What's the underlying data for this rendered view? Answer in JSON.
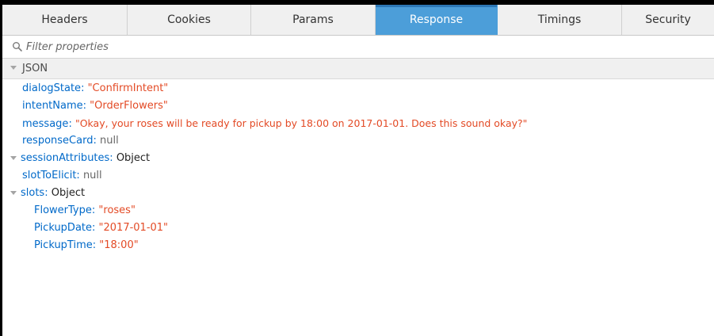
{
  "tabs": [
    {
      "label": "Headers",
      "active": false
    },
    {
      "label": "Cookies",
      "active": false
    },
    {
      "label": "Params",
      "active": false
    },
    {
      "label": "Response",
      "active": true
    },
    {
      "label": "Timings",
      "active": false
    },
    {
      "label": "Security",
      "active": false
    }
  ],
  "filter": {
    "placeholder": "Filter properties",
    "icon": "search-icon"
  },
  "json_section": {
    "label": "JSON",
    "expanded": true
  },
  "properties": [
    {
      "key": "dialogState",
      "value": "\"ConfirmIntent\"",
      "type": "string"
    },
    {
      "key": "intentName",
      "value": "\"OrderFlowers\"",
      "type": "string"
    },
    {
      "key": "message",
      "value": "\"Okay, your roses will be ready for pickup by 18:00 on 2017-01-01.  Does this sound okay?\"",
      "type": "string"
    },
    {
      "key": "responseCard",
      "value": "null",
      "type": "null"
    },
    {
      "key": "sessionAttributes",
      "value": "Object",
      "type": "object",
      "expanded": true
    },
    {
      "key": "slotToElicit",
      "value": "null",
      "type": "null"
    },
    {
      "key": "slots",
      "value": "Object",
      "type": "object",
      "expanded": true,
      "children": [
        {
          "key": "FlowerType",
          "value": "\"roses\"",
          "type": "string"
        },
        {
          "key": "PickupDate",
          "value": "\"2017-01-01\"",
          "type": "string"
        },
        {
          "key": "PickupTime",
          "value": "\"18:00\"",
          "type": "string"
        }
      ]
    }
  ],
  "colors": {
    "key": "#0069c9",
    "string": "#e34a25",
    "active_tab": "#4c9ed9",
    "toolbar_bg": "#f0f0f0"
  }
}
